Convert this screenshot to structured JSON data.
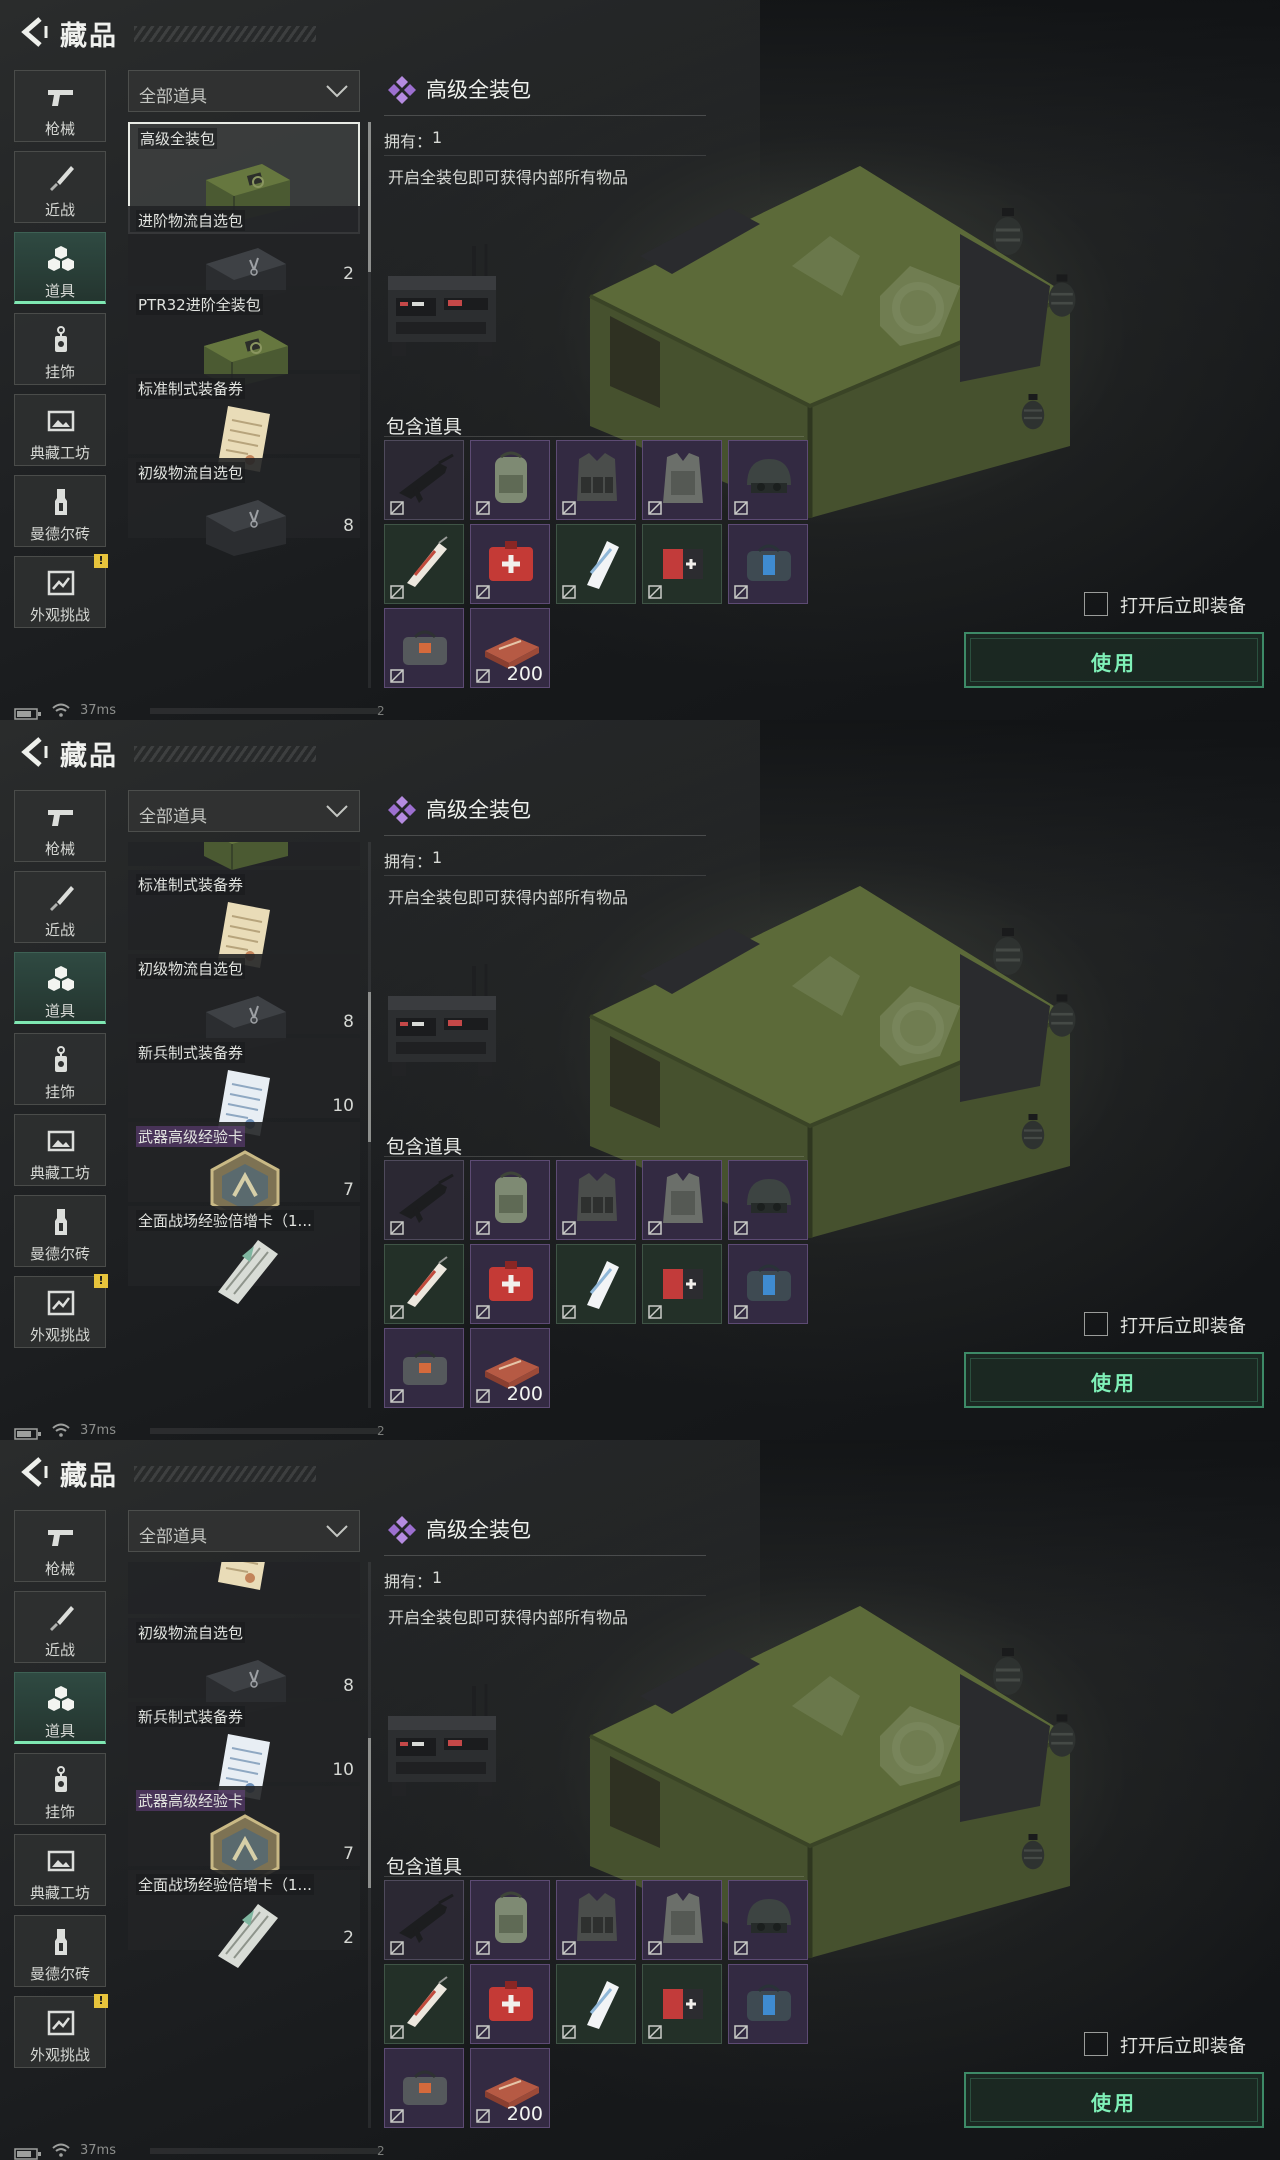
{
  "page": {
    "title": "藏品",
    "categories": [
      {
        "label": "枪械",
        "icon": "pistol-icon",
        "active": false,
        "badge": ""
      },
      {
        "label": "近战",
        "icon": "knife-icon",
        "active": false,
        "badge": ""
      },
      {
        "label": "道具",
        "icon": "items-stack-icon",
        "active": true,
        "badge": ""
      },
      {
        "label": "挂饰",
        "icon": "charm-icon",
        "active": false,
        "badge": ""
      },
      {
        "label": "典藏工坊",
        "icon": "gallery-icon",
        "active": false,
        "badge": ""
      },
      {
        "label": "曼德尔砖",
        "icon": "mandel-brick-icon",
        "active": false,
        "badge": ""
      },
      {
        "label": "外观挑战",
        "icon": "appearance-challenge-icon",
        "active": false,
        "badge": "!"
      }
    ],
    "filter": {
      "label": "全部道具"
    },
    "detail": {
      "title": "高级全装包",
      "owned_label": "拥有：",
      "owned_value": "1",
      "description": "开启全装包即可获得内部所有物品",
      "contents_label": "包含道具",
      "contents": [
        {
          "icon": "rifle-icon",
          "rarity": "default",
          "count": ""
        },
        {
          "icon": "backpack-icon",
          "rarity": "purple",
          "count": ""
        },
        {
          "icon": "chest-rig-icon",
          "rarity": "purple",
          "count": ""
        },
        {
          "icon": "armor-vest-icon",
          "rarity": "purple",
          "count": ""
        },
        {
          "icon": "helmet-icon",
          "rarity": "purple",
          "count": ""
        },
        {
          "icon": "syringe-icon",
          "rarity": "green",
          "count": ""
        },
        {
          "icon": "medkit-icon",
          "rarity": "purple",
          "count": ""
        },
        {
          "icon": "bandage-icon",
          "rarity": "green",
          "count": ""
        },
        {
          "icon": "first-aid-pouch-icon",
          "rarity": "green",
          "count": ""
        },
        {
          "icon": "medical-bag-icon",
          "rarity": "purple",
          "count": ""
        },
        {
          "icon": "tool-bag-icon",
          "rarity": "purple",
          "count": ""
        },
        {
          "icon": "ammo-box-icon",
          "rarity": "purple",
          "count": "200"
        }
      ],
      "equip_after_open_label": "打开后立即装备",
      "use_button_label": "使用"
    },
    "status": {
      "ping": "37ms",
      "page_number": "2"
    }
  },
  "panels": [
    {
      "items": [
        {
          "name": "高级全装包",
          "count": "",
          "icon": "green-crate-icon",
          "selected": true,
          "purple": false
        },
        {
          "name": "进阶物流自选包",
          "count": "2",
          "icon": "black-crate-icon",
          "selected": false,
          "purple": false
        },
        {
          "name": "PTR32进阶全装包",
          "count": "",
          "icon": "green-crate-icon",
          "selected": false,
          "purple": false
        },
        {
          "name": "标准制式装备券",
          "count": "",
          "icon": "paper-voucher-icon",
          "selected": false,
          "purple": false
        },
        {
          "name": "初级物流自选包",
          "count": "8",
          "icon": "black-crate-icon",
          "selected": false,
          "purple": false
        }
      ]
    },
    {
      "items": [
        {
          "name": "",
          "count": "",
          "icon": "green-crate-icon",
          "selected": false,
          "purple": false
        },
        {
          "name": "标准制式装备券",
          "count": "",
          "icon": "paper-voucher-icon",
          "selected": false,
          "purple": false
        },
        {
          "name": "初级物流自选包",
          "count": "8",
          "icon": "black-crate-icon",
          "selected": false,
          "purple": false
        },
        {
          "name": "新兵制式装备券",
          "count": "10",
          "icon": "blue-voucher-icon",
          "selected": false,
          "purple": false
        },
        {
          "name": "武器高级经验卡",
          "count": "7",
          "icon": "weapon-exp-card-icon",
          "selected": false,
          "purple": true
        },
        {
          "name": "全面战场经验倍增卡（1...",
          "count": "",
          "icon": "exp-multiplier-card-icon",
          "selected": false,
          "purple": false
        }
      ]
    },
    {
      "items": [
        {
          "name": "",
          "count": "",
          "icon": "paper-voucher-icon",
          "selected": false,
          "purple": false
        },
        {
          "name": "初级物流自选包",
          "count": "8",
          "icon": "black-crate-icon",
          "selected": false,
          "purple": false
        },
        {
          "name": "新兵制式装备券",
          "count": "10",
          "icon": "blue-voucher-icon",
          "selected": false,
          "purple": false
        },
        {
          "name": "武器高级经验卡",
          "count": "7",
          "icon": "weapon-exp-card-icon",
          "selected": false,
          "purple": true
        },
        {
          "name": "全面战场经验倍增卡（1...",
          "count": "2",
          "icon": "exp-multiplier-card-icon",
          "selected": false,
          "purple": false
        }
      ]
    }
  ],
  "colors": {
    "accent": "#7fe7b2",
    "badge": "#e7c43c",
    "rarity_purple": "#5d4b74",
    "rarity_green": "#3f5446"
  }
}
